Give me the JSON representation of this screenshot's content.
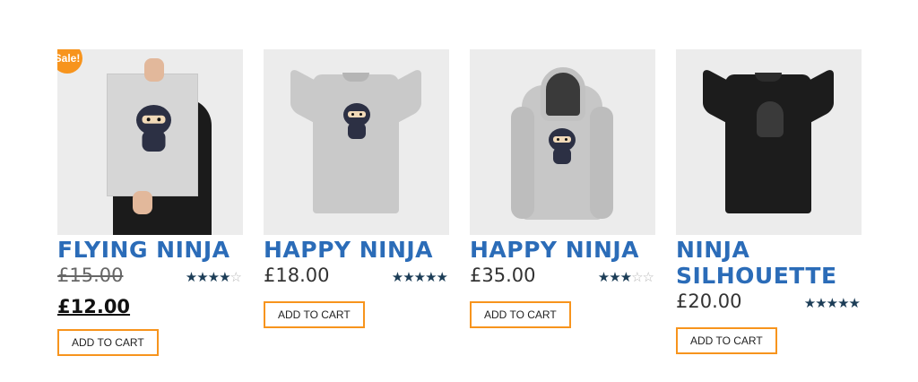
{
  "products": [
    {
      "title": "FLYING NINJA",
      "price_old": "£15.00",
      "price": "£12.00",
      "sale_badge": "Sale!",
      "rating": 4,
      "button": "ADD TO CART"
    },
    {
      "title": "HAPPY NINJA",
      "price": "£18.00",
      "rating": 5,
      "button": "ADD TO CART"
    },
    {
      "title": "HAPPY NINJA",
      "price": "£35.00",
      "rating": 3,
      "button": "ADD TO CART"
    },
    {
      "title": "NINJA SILHOUETTE",
      "price": "£20.00",
      "rating": 5,
      "button": "ADD TO CART"
    }
  ],
  "colors": {
    "accent": "#f7941d",
    "title": "#2b6cb8",
    "stars": "#1c3d57"
  }
}
